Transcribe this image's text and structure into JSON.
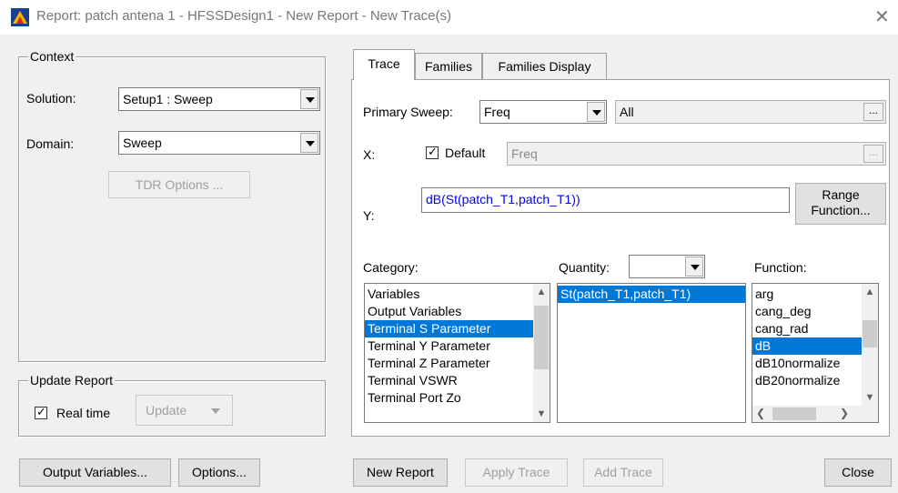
{
  "window": {
    "title": "Report: patch antena 1 - HFSSDesign1 - New Report - New Trace(s)",
    "close_glyph": "✕"
  },
  "context": {
    "legend": "Context",
    "solution_label": "Solution:",
    "solution_value": "Setup1 : Sweep",
    "domain_label": "Domain:",
    "domain_value": "Sweep",
    "tdr_options_label": "TDR Options ..."
  },
  "update_report": {
    "legend": "Update Report",
    "realtime_label": "Real time",
    "realtime_checked": true,
    "update_label": "Update"
  },
  "tabs": [
    {
      "label": "Trace",
      "active": true
    },
    {
      "label": "Families",
      "active": false
    },
    {
      "label": "Families Display",
      "active": false
    }
  ],
  "trace": {
    "primary_sweep_label": "Primary Sweep:",
    "primary_sweep_value": "Freq",
    "primary_sweep_range": "All",
    "ellipsis": "...",
    "x_label": "X:",
    "default_label": "Default",
    "default_checked": true,
    "x_value": "Freq",
    "y_label": "Y:",
    "y_value": "dB(St(patch_T1,patch_T1))",
    "range_function_label_1": "Range",
    "range_function_label_2": "Function...",
    "category_label": "Category:",
    "quantity_label": "Quantity:",
    "function_label": "Function:",
    "categories": [
      "Variables",
      "Output Variables",
      "Terminal S Parameter",
      "Terminal Y Parameter",
      "Terminal Z Parameter",
      "Terminal VSWR",
      "Terminal Port Zo"
    ],
    "category_selected": "Terminal S Parameter",
    "quantities": [
      "St(patch_T1,patch_T1)"
    ],
    "quantity_selected": "St(patch_T1,patch_T1)",
    "functions": [
      "arg",
      "cang_deg",
      "cang_rad",
      "dB",
      "dB10normalize",
      "dB20normalize"
    ],
    "function_selected": "dB"
  },
  "footer": {
    "output_variables_label": "Output Variables...",
    "options_label": "Options...",
    "new_report_label": "New Report",
    "apply_trace_label": "Apply Trace",
    "add_trace_label": "Add Trace",
    "close_label": "Close"
  },
  "colors": {
    "selection": "#0078d7",
    "y_expression_text": "#0000ff"
  }
}
